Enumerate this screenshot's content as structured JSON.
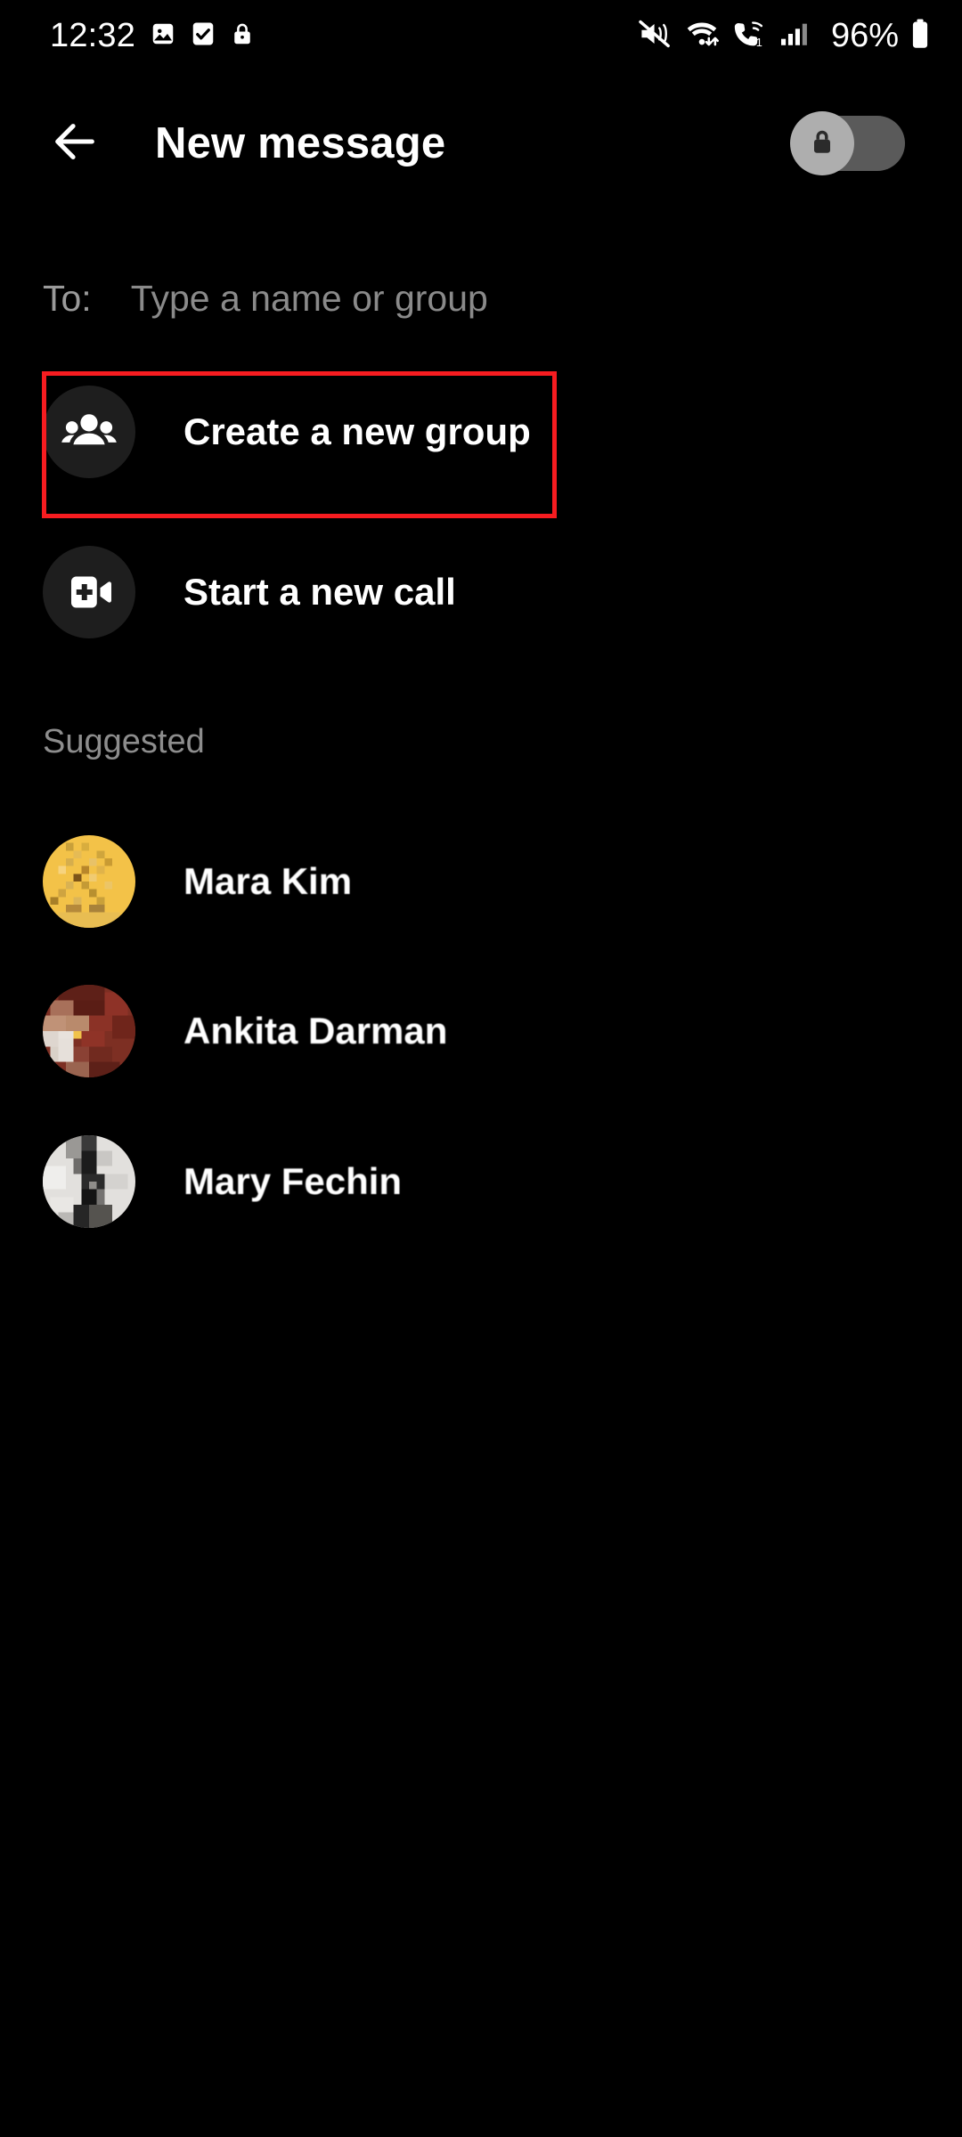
{
  "status_bar": {
    "time": "12:32",
    "left_icons": [
      "image-icon",
      "checkbox-icon",
      "lock-icon"
    ],
    "right_icons": [
      "mute-icon",
      "wifi-icon",
      "wifi-calling-icon",
      "signal-icon",
      "battery-icon"
    ],
    "battery_percent": "96%"
  },
  "header": {
    "back_icon": "back-arrow-icon",
    "title": "New message",
    "encryption_toggle": {
      "icon": "lock-icon",
      "state": "off"
    }
  },
  "recipient": {
    "label": "To:",
    "placeholder": "Type a name or group",
    "value": ""
  },
  "actions": [
    {
      "label": "Create a new group",
      "icon": "group-people-icon",
      "highlighted": true
    },
    {
      "label": "Start a new call",
      "icon": "video-call-add-icon",
      "highlighted": false
    }
  ],
  "suggested": {
    "section_label": "Suggested",
    "contacts": [
      {
        "name": "Mara Kim",
        "avatar_color": "#f3c248"
      },
      {
        "name": "Ankita Darman",
        "avatar_color": "#7d2f23"
      },
      {
        "name": "Mary Fechin",
        "avatar_color": "#d9d9d9"
      }
    ]
  },
  "colors": {
    "background": "#000000",
    "highlight": "#f71c20",
    "icon_circle": "#1e1e1e",
    "muted_text": "#8d8d8d"
  }
}
